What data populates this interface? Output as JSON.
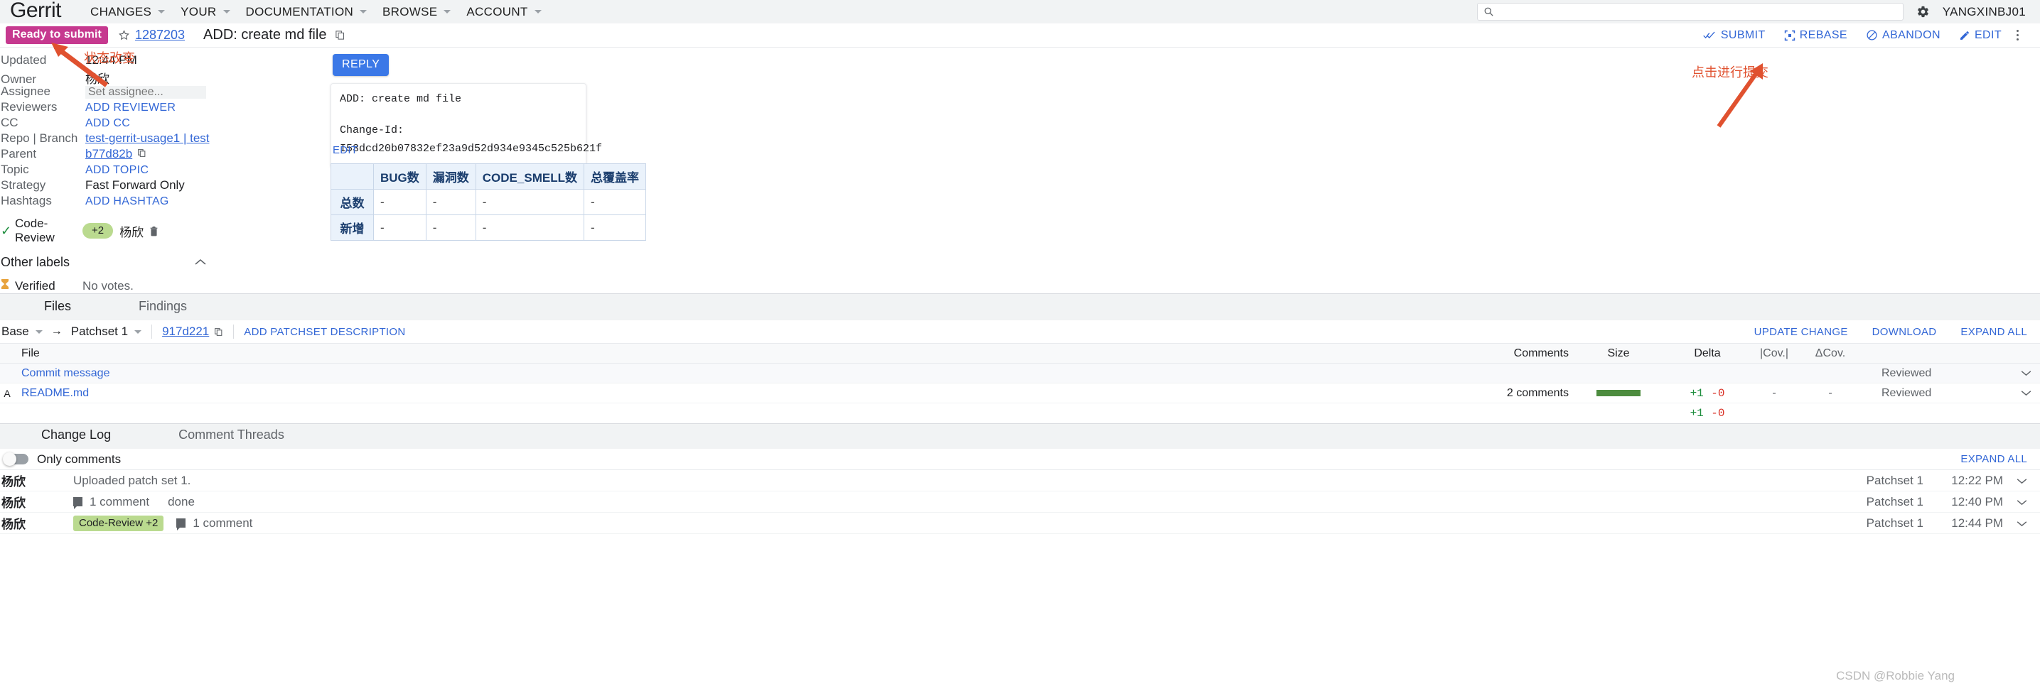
{
  "colors": {
    "accent_blue": "#3367d6",
    "status_chip_bg": "#c6398f",
    "vote_chip_bg": "#bada8f",
    "annotation_red": "#e0512f",
    "size_bar_green": "#4d8c3f",
    "added_green": "#1e8e3e",
    "removed_red": "#d93025"
  },
  "topbar": {
    "brand": "Gerrit",
    "nav": [
      {
        "label": "CHANGES",
        "has_caret": true
      },
      {
        "label": "YOUR",
        "has_caret": true
      },
      {
        "label": "DOCUMENTATION",
        "has_caret": true
      },
      {
        "label": "BROWSE",
        "has_caret": true
      },
      {
        "label": "ACCOUNT",
        "has_caret": true
      }
    ],
    "search": {
      "value": "",
      "placeholder": "",
      "icon": "search-icon"
    },
    "settings_icon": "gear-icon",
    "username": "YANGXINBJ01"
  },
  "change_header": {
    "status": "Ready to submit",
    "star_icon": "star-outline-icon",
    "change_number": "1287203",
    "title": "ADD: create md file",
    "copy_icon": "copy-icon",
    "actions": [
      {
        "label": "SUBMIT",
        "icon": "double-check-icon"
      },
      {
        "label": "REBASE",
        "icon": "rebase-icon"
      },
      {
        "label": "ABANDON",
        "icon": "block-icon"
      },
      {
        "label": "EDIT",
        "icon": "pencil-icon"
      }
    ],
    "overflow_icon": "kebab-menu-icon"
  },
  "metadata": [
    {
      "label": "Updated",
      "value": "12:44 PM",
      "kind": "text"
    },
    {
      "label": "Owner",
      "value": "杨欣",
      "kind": "text"
    },
    {
      "label": "Assignee",
      "value": "",
      "placeholder": "Set assignee...",
      "kind": "input"
    },
    {
      "label": "Reviewers",
      "value": "ADD REVIEWER",
      "kind": "action"
    },
    {
      "label": "CC",
      "value": "ADD CC",
      "kind": "action"
    },
    {
      "label": "Repo | Branch",
      "value": "test-gerrit-usage1 | test",
      "kind": "links"
    },
    {
      "label": "Parent",
      "value": "b77d82b",
      "kind": "link-copy"
    },
    {
      "label": "Topic",
      "value": "ADD TOPIC",
      "kind": "action"
    },
    {
      "label": "Strategy",
      "value": "Fast Forward Only",
      "kind": "text"
    },
    {
      "label": "Hashtags",
      "value": "ADD HASHTAG",
      "kind": "action"
    }
  ],
  "labels": {
    "code_review": {
      "name": "Code-Review",
      "status_icon": "check-icon",
      "vote": "+2",
      "voter": "杨欣",
      "delete_icon": "trash-icon"
    },
    "other_labels_title": "Other labels",
    "collapse_icon": "chevron-up-icon",
    "verified": {
      "name": "Verified",
      "status_icon": "hourglass-icon",
      "value": "No votes."
    }
  },
  "commit": {
    "reply_label": "REPLY",
    "message_line1": "ADD: create md file",
    "message_line2": "Change-Id: I53dcd20b07832ef23a9d52d934e9345c525b621f",
    "edit_label": "EDIT"
  },
  "metrics_table": {
    "corner": "",
    "columns": [
      "BUG数",
      "漏洞数",
      "CODE_SMELL数",
      "总覆盖率"
    ],
    "rows": [
      {
        "label": "总数",
        "values": [
          "-",
          "-",
          "-",
          "-"
        ]
      },
      {
        "label": "新增",
        "values": [
          "-",
          "-",
          "-",
          "-"
        ]
      }
    ]
  },
  "annotations": [
    {
      "text": "状态改变",
      "target": "status-chip"
    },
    {
      "text": "点击进行提交",
      "target": "submit-button"
    }
  ],
  "files_section": {
    "tabs": [
      {
        "label": "Files",
        "selected": true
      },
      {
        "label": "Findings",
        "selected": false
      }
    ],
    "patchset_bar": {
      "base": "Base",
      "arrow": "→",
      "patchset": "Patchset 1",
      "sha": "917d221",
      "copy_icon": "copy-icon",
      "add_description": "ADD PATCHSET DESCRIPTION",
      "right_actions": [
        "UPDATE CHANGE",
        "DOWNLOAD",
        "EXPAND ALL"
      ]
    },
    "columns": {
      "status": "",
      "file": "File",
      "comments": "Comments",
      "size": "Size",
      "delta": "Delta",
      "coverage": "|Cov.|",
      "delta_coverage": "ΔCov.",
      "reviewed": "",
      "expand": ""
    },
    "rows": [
      {
        "status": "",
        "file": "Commit message",
        "comments": "",
        "size_bar": false,
        "delta_added": "",
        "delta_removed": "",
        "coverage": "",
        "delta_coverage": "",
        "reviewed": "Reviewed",
        "expand_icon": "chevron-down-icon"
      },
      {
        "status": "A",
        "file": "README.md",
        "comments": "2 comments",
        "size_bar": true,
        "delta_added": "+1",
        "delta_removed": "-0",
        "coverage": "-",
        "delta_coverage": "-",
        "reviewed": "Reviewed",
        "expand_icon": "chevron-down-icon"
      }
    ],
    "totals": {
      "delta_added": "+1",
      "delta_removed": "-0"
    }
  },
  "change_log": {
    "tabs": [
      {
        "label": "Change Log",
        "selected": true
      },
      {
        "label": "Comment Threads",
        "selected": false
      }
    ],
    "only_comments_label": "Only comments",
    "only_comments_on": false,
    "expand_all": "EXPAND ALL",
    "entries": [
      {
        "author": "杨欣",
        "message": "Uploaded patch set 1.",
        "chip": "",
        "comment_count": "",
        "extra": "",
        "patchset": "Patchset 1",
        "time": "12:22 PM",
        "expand_icon": "chevron-down-icon"
      },
      {
        "author": "杨欣",
        "message": "",
        "chip": "",
        "comment_count": "1 comment",
        "extra": "done",
        "patchset": "Patchset 1",
        "time": "12:40 PM",
        "expand_icon": "chevron-down-icon"
      },
      {
        "author": "杨欣",
        "message": "",
        "chip": "Code-Review +2",
        "comment_count": "1 comment",
        "extra": "",
        "patchset": "Patchset 1",
        "time": "12:44 PM",
        "expand_icon": "chevron-down-icon"
      }
    ]
  },
  "watermark": "CSDN @Robbie Yang"
}
